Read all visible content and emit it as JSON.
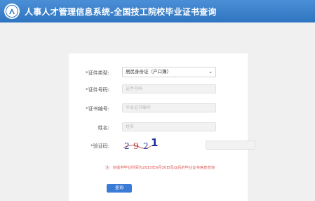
{
  "header": {
    "logo_icon": "system-logo-icon",
    "title": "人事人才管理信息系统-全国技工院校毕业证书查询"
  },
  "form": {
    "id_type": {
      "label": "*证件类型:",
      "value": "居民身份证（户口簿）"
    },
    "id_number": {
      "label": "*证件号码:",
      "placeholder": "证件号码"
    },
    "cert_number": {
      "label": "*证书编号:",
      "placeholder": "毕业证书编号"
    },
    "name": {
      "label": "姓名:",
      "placeholder": "姓名"
    },
    "captcha": {
      "label": "*验证码:",
      "chars": [
        "2",
        "9",
        "2"
      ],
      "extra_char": "1"
    },
    "note": "注：仅提供毕业时间为2015年6月30日及以后的毕业证书信息查询",
    "submit_label": "查询"
  },
  "colors": {
    "header": "#2f74c0",
    "button": "#3a7bd5",
    "note": "#d9534f"
  }
}
